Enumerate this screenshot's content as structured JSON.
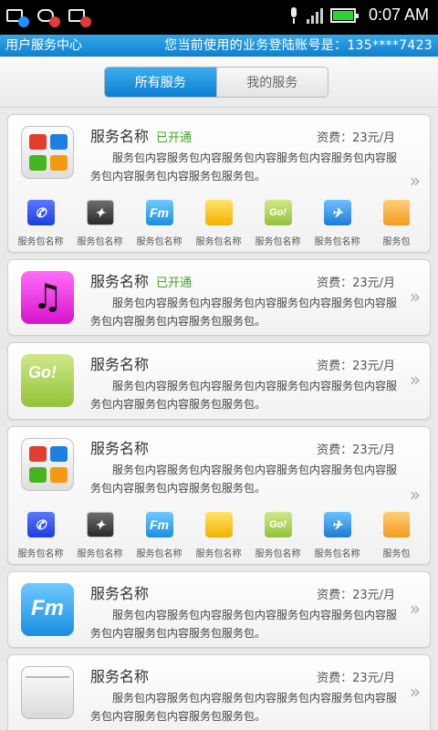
{
  "statusbar": {
    "time": "0:07 AM",
    "icons": [
      "usb-debug-icon",
      "missed-call-icon",
      "contacts-icon",
      "mic-icon",
      "signal-icon",
      "battery-icon"
    ]
  },
  "titlebar": {
    "title": "用户服务中心",
    "account_text": "您当前使用的业务登陆账号是：135****7423"
  },
  "tabs": {
    "all": "所有服务",
    "mine": "我的服务",
    "active": "all"
  },
  "cards": [
    {
      "icon": "multi-service-icon",
      "name": "服务名称",
      "status": "已开通",
      "fee": "资费：23元/月",
      "desc": "服务包内容服务包内容服务包内容服务包内容服务包内容服务包内容服务包内容服务包服务包。",
      "packages": [
        "服务包名称",
        "服务包名称",
        "服务包名称",
        "服务包名称",
        "服务包名称",
        "服务包名称",
        "服务包"
      ]
    },
    {
      "icon": "music-icon",
      "name": "服务名称",
      "status": "已开通",
      "fee": "资费：23元/月",
      "desc": "服务包内容服务包内容服务包内容服务包内容服务包内容服务包内容服务包内容服务包服务包。"
    },
    {
      "icon": "go-icon",
      "name": "服务名称",
      "status": "",
      "fee": "资费：23元/月",
      "desc": "服务包内容服务包内容服务包内容服务包内容服务包内容服务包内容服务包内容服务包服务包。"
    },
    {
      "icon": "multi-service-icon",
      "name": "服务名称",
      "status": "",
      "fee": "资费：23元/月",
      "desc": "服务包内容服务包内容服务包内容服务包内容服务包内容服务包内容服务包内容服务包服务包。",
      "packages": [
        "服务包名称",
        "服务包名称",
        "服务包名称",
        "服务包名称",
        "服务包名称",
        "服务包名称",
        "服务包"
      ]
    },
    {
      "icon": "fm-icon",
      "name": "服务名称",
      "status": "",
      "fee": "资费：23元/月",
      "desc": "服务包内容服务包内容服务包内容服务包内容服务包内容服务包内容服务包内容服务包服务包。"
    },
    {
      "icon": "mail-icon",
      "name": "服务名称",
      "status": "",
      "fee": "资费：23元/月",
      "desc": "服务包内容服务包内容服务包内容服务包内容服务包内容服务包内容服务包内容服务包服务包。"
    }
  ],
  "package_icons": [
    "phone-icon",
    "game-icon",
    "fm-icon",
    "folder-icon",
    "go-icon",
    "globe-icon",
    "orange-icon"
  ],
  "package_glyphs": {
    "fm": "Fm",
    "go": "Go!"
  },
  "music_glyph": "♫",
  "fm_glyph": "Fm",
  "go_glyph": "Go!",
  "chevron": "»",
  "colors": {
    "accent_blue": "#1587d9",
    "status_green": "#3aa820",
    "battery_green": "#2fd233"
  }
}
